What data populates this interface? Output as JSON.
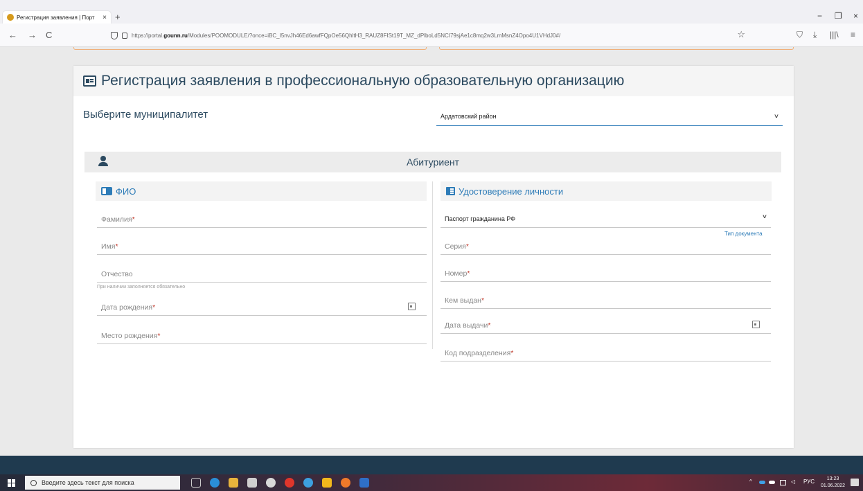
{
  "browser": {
    "tab_title": "Регистрация заявления | Порт",
    "tab_close": "×",
    "new_tab": "+",
    "url_domain_prefix": "https://portal.",
    "url_domain": "gounn.ru",
    "url_path": "/Modules/POOMODULE/?once=iBC_I5nvJh46Ed6awfFQpOe56QhltH3_RAUZ8FISt19T_MZ_dPlboLd5NCI79sjAe1c8mq2w3LmMsnZ4Opo4U1VHdJ0#/",
    "window_controls": {
      "minimize": "−",
      "restore": "❐",
      "close": "×"
    },
    "nav": {
      "back": "←",
      "forward": "→",
      "reload": "C"
    },
    "bookmark_star": "☆",
    "right_icons": {
      "pocket": "⛉",
      "download": "⤓",
      "library": "|||\\",
      "menu": "≡"
    }
  },
  "page": {
    "title": "Регистрация заявления в профессиональную образовательную организацию",
    "municipality_label": "Выберите муниципалитет",
    "municipality_value": "Ардатовский район",
    "section_title": "Абитуриент",
    "fio": {
      "header": "ФИО",
      "surname": "Фамилия",
      "name": "Имя",
      "patronymic": "Отчество",
      "patronymic_hint": "При наличии заполняется обязательно",
      "birth_date": "Дата рождения",
      "birth_place": "Место рождения"
    },
    "identity": {
      "header": "Удостоверение личности",
      "doc_type_value": "Паспорт гражданина РФ",
      "doc_type_label": "Тип документа",
      "series": "Серия",
      "number": "Номер",
      "issued_by": "Кем выдан",
      "issue_date": "Дата выдачи",
      "department_code": "Код подразделения"
    },
    "required_mark": "*"
  },
  "taskbar": {
    "search_placeholder": "Введите здесь текст для поиска",
    "lang": "РУС",
    "time": "13:23",
    "date": "01.06.2022",
    "tray_arrow": "^"
  },
  "colors": {
    "accent": "#2e7cb8",
    "title": "#2c4a60",
    "required": "#c0392b",
    "footer": "#1f3a4f"
  }
}
